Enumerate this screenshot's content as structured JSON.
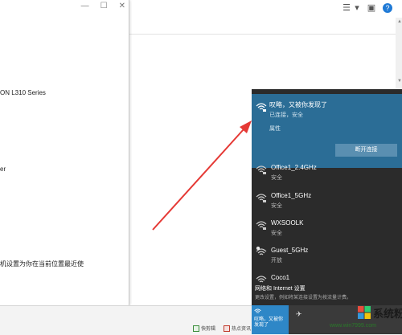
{
  "left_window": {
    "printer_text": "ON L310 Series",
    "partial_text": "er",
    "hint_text": "机设置为你在当前位置最近使"
  },
  "network_flyout": {
    "connected": {
      "name": "叹略，又被你发现了",
      "status": "已连接，安全",
      "properties_label": "属性",
      "disconnect_label": "断开连接"
    },
    "networks": [
      {
        "name": "Office1_2.4GHz",
        "status": "安全",
        "icon": "wifi-secure-icon"
      },
      {
        "name": "Office1_5GHz",
        "status": "安全",
        "icon": "wifi-secure-icon"
      },
      {
        "name": "WXSOOLK",
        "status": "安全",
        "icon": "wifi-secure-icon"
      },
      {
        "name": "Guest_5GHz",
        "status": "开放",
        "icon": "wifi-open-icon"
      },
      {
        "name": "Coco1",
        "status": "",
        "icon": "wifi-icon"
      }
    ],
    "settings_label": "网络和 Internet 设置",
    "settings_sublabel": "更改设置，例如将某连接设置为按流量计费。"
  },
  "quick_tiles": {
    "wifi_tile_label_line1": "叹略，又被你",
    "wifi_tile_label_line2": "发现了"
  },
  "status_bar": {
    "item1": "快剪辑",
    "item2": "热点资讯"
  },
  "watermark": {
    "brand": "系统粉",
    "url": "www.win7999.com"
  },
  "colors": {
    "flyout_bg": "#2b2b2b",
    "connected_bg": "#2b6d96",
    "tile_active": "#2e87c7",
    "arrow": "#e53935"
  }
}
